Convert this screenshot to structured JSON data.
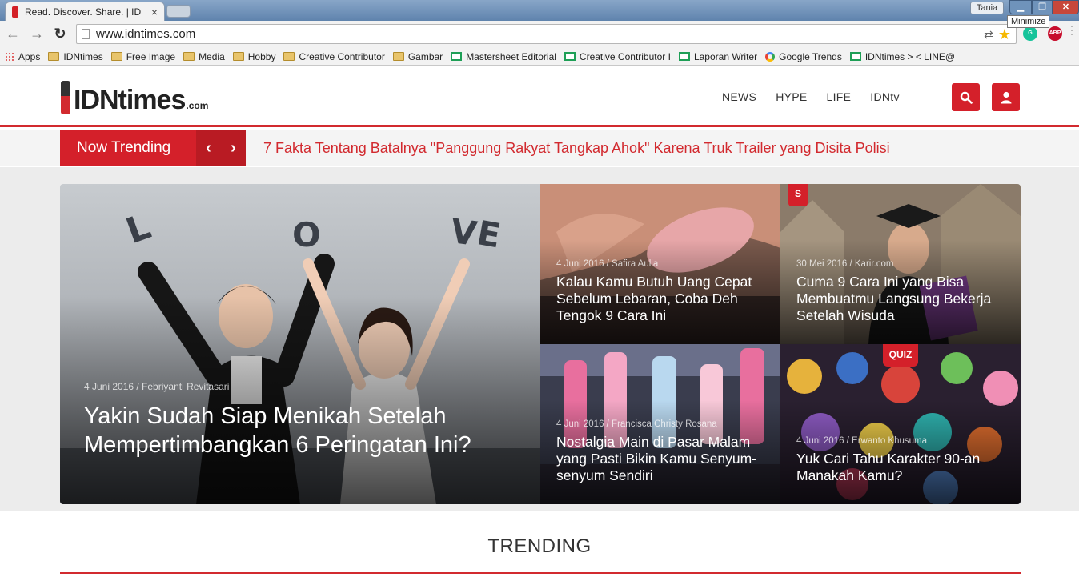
{
  "browser": {
    "tab_title": "Read. Discover. Share. | ID",
    "tab_close": "×",
    "user": "Tania",
    "tooltip": "Minimize",
    "url": "www.idntimes.com",
    "abp_label": "ABP",
    "bookmarks": [
      {
        "label": "Apps",
        "icon": "apps-grid-icon"
      },
      {
        "label": "IDNtimes",
        "icon": "folder-icon"
      },
      {
        "label": "Free Image",
        "icon": "folder-icon"
      },
      {
        "label": "Media",
        "icon": "folder-icon"
      },
      {
        "label": "Hobby",
        "icon": "folder-icon"
      },
      {
        "label": "Creative Contributor",
        "icon": "folder-icon"
      },
      {
        "label": "Gambar",
        "icon": "folder-icon"
      },
      {
        "label": "Mastersheet Editorial",
        "icon": "sheets-icon"
      },
      {
        "label": "Creative Contributor I",
        "icon": "sheets-icon"
      },
      {
        "label": "Laporan Writer",
        "icon": "sheets-icon"
      },
      {
        "label": "Google Trends",
        "icon": "google-icon"
      },
      {
        "label": "IDNtimes > < LINE@",
        "icon": "sheets-icon"
      }
    ]
  },
  "site": {
    "logo_text": "IDNtimes",
    "logo_suffix": ".com",
    "nav": [
      "NEWS",
      "HYPE",
      "LIFE",
      "IDNtv"
    ],
    "brand_color": "#d4202a"
  },
  "trending_bar": {
    "label": "Now Trending",
    "headline": "7 Fakta Tentang Batalnya \"Panggung Rakyat Tangkap Ahok\" Karena Truk Trailer yang Disita Polisi"
  },
  "hero": {
    "main": {
      "meta": "4 Juni 2016 / Febriyanti Revitasari",
      "title": "Yakin Sudah Siap Menikah Setelah Mempertimbangkan 6 Peringatan Ini?",
      "letters": [
        "L",
        "O",
        "V",
        "E"
      ]
    },
    "cards": [
      {
        "meta": "4 Juni 2016 / Safira Aulia",
        "title": "Kalau Kamu Butuh Uang Cepat Sebelum Lebaran, Coba Deh Tengok 9 Cara Ini"
      },
      {
        "meta": "30 Mei 2016 / Karir.com",
        "title": "Cuma 9 Cara Ini yang Bisa Membuatmu Langsung Bekerja Setelah Wisuda",
        "badge": "S"
      },
      {
        "meta": "4 Juni 2016 / Francisca Christy Rosana",
        "title": "Nostalgia Main di Pasar Malam yang Pasti Bikin Kamu Senyum-senyum Sendiri"
      },
      {
        "meta": "4 Juni 2016 / Erwanto Khusuma",
        "title": "Yuk Cari Tahu Karakter 90-an Manakah Kamu?",
        "badge": "QUIZ"
      }
    ]
  },
  "trending_section": {
    "title": "TRENDING"
  }
}
